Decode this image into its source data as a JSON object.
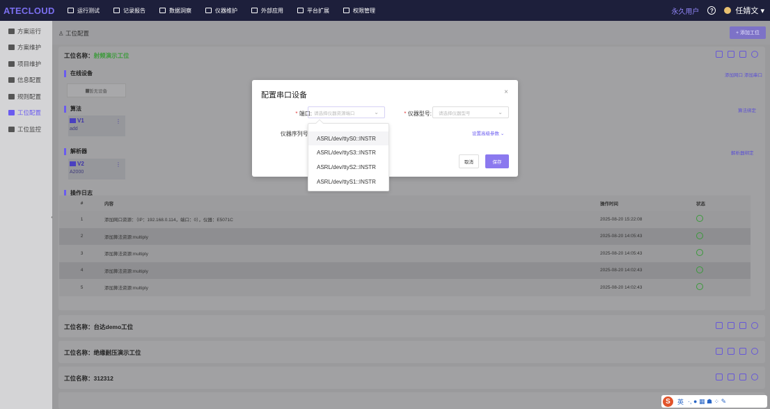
{
  "app": {
    "logo": "ATECLOUD"
  },
  "nav": [
    {
      "label": "运行测试",
      "icon": "monitor-icon"
    },
    {
      "label": "记录报告",
      "icon": "document-icon"
    },
    {
      "label": "数据洞察",
      "icon": "chart-icon"
    },
    {
      "label": "仪器维护",
      "icon": "instrument-icon"
    },
    {
      "label": "外部应用",
      "icon": "grid-icon"
    },
    {
      "label": "平台扩展",
      "icon": "cluster-icon"
    },
    {
      "label": "权限管理",
      "icon": "users-icon"
    }
  ],
  "user": {
    "type": "永久用户",
    "help": "?",
    "name": "任婧文",
    "dropdown": "▾"
  },
  "sidebar": [
    {
      "label": "方案运行",
      "active": false
    },
    {
      "label": "方案维护",
      "active": false
    },
    {
      "label": "项目维护",
      "active": false
    },
    {
      "label": "信息配置",
      "active": false
    },
    {
      "label": "规则配置",
      "active": false
    },
    {
      "label": "工位配置",
      "active": true
    },
    {
      "label": "工位监控",
      "active": false
    }
  ],
  "page": {
    "breadcrumb": "工位配置",
    "add_button": "+ 添加工位",
    "collapse": "‹"
  },
  "station": {
    "title_prefix": "工位名称：",
    "title_name": "射频演示工位",
    "online_devices": {
      "label": "在线设备",
      "links": [
        "添加网口",
        "添加串口"
      ],
      "empty": "暂无设备"
    },
    "algorithm": {
      "label": "算法",
      "link": "算法绑定",
      "tag": "V1",
      "sub": "add",
      "menu": "⋮"
    },
    "parser": {
      "label": "解析器",
      "link": "解析器绑定",
      "tag": "V2",
      "sub": "A2000",
      "menu": "⋮"
    },
    "log": {
      "label": "操作日志",
      "headers": [
        "#",
        "内容",
        "操作时间",
        "状态"
      ],
      "rows": [
        {
          "n": "1",
          "content": "添加网口资源：（IP：192.168.0.114，端口：0），仪器：E5071C",
          "time": "2025-08-20 15:22:08"
        },
        {
          "n": "2",
          "content": "添加算法资源:multiply",
          "time": "2025-08-20 14:05:43"
        },
        {
          "n": "3",
          "content": "添加算法资源:multiply",
          "time": "2025-08-20 14:05:43"
        },
        {
          "n": "4",
          "content": "添加算法资源:multiply",
          "time": "2025-08-20 14:02:43"
        },
        {
          "n": "5",
          "content": "添加算法资源:multiply",
          "time": "2025-08-20 14:02:43"
        }
      ]
    }
  },
  "other_stations": [
    {
      "title": "工位名称：台达demo工位"
    },
    {
      "title": "工位名称：绝缘耐压演示工位"
    },
    {
      "title": "工位名称：312312"
    }
  ],
  "modal": {
    "title": "配置串口设备",
    "close": "×",
    "port_label": "端口:",
    "port_placeholder": "请选择仪器资源端口",
    "model_label": "仪器型号:",
    "model_placeholder": "请选择仪器型号",
    "serial_label": "仪器序列号:",
    "required_mark": "*",
    "advanced": "设置高级参数",
    "cancel": "取消",
    "save": "保存",
    "arrow": "⌄",
    "port_options": [
      "ASRL/dev/ttyS0::INSTR",
      "ASRL/dev/ttyS3::INSTR",
      "ASRL/dev/ttyS2::INSTR",
      "ASRL/dev/ttyS1::INSTR"
    ]
  },
  "ime": {
    "logo": "S",
    "lang": "英",
    "icons": "·, ● ▦ ☗ ⁘ ✎"
  },
  "colors": {
    "accent": "#6a5bf0",
    "topbar": "#1d1f3b",
    "success": "#3a9a3a"
  }
}
